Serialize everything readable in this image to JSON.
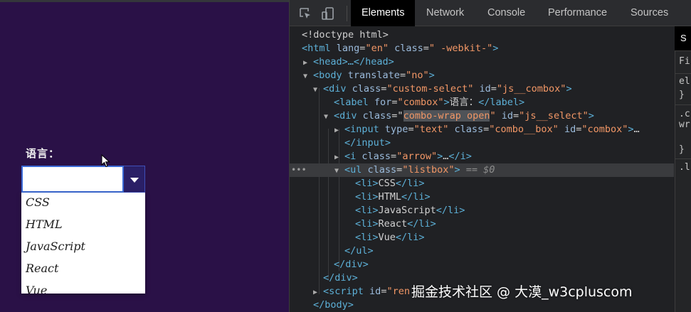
{
  "page": {
    "label": "语言：",
    "combo_value": "",
    "options": [
      "CSS",
      "HTML",
      "JavaScript",
      "React",
      "Vue"
    ]
  },
  "devtools": {
    "tabs": [
      "Elements",
      "Network",
      "Console",
      "Performance",
      "Sources"
    ],
    "active_tab": "Elements",
    "side_tab": "S",
    "side_rows": [
      "Fi",
      "el",
      "}",
      ".c",
      "wr",
      "}",
      ".l"
    ],
    "dom_lines": {
      "l0": "<!doctype html>",
      "l1_tag": "<html",
      "l1_a1": "lang",
      "l1_v1": "\"en\"",
      "l1_a2": "class",
      "l1_v2": "\" -webkit-\"",
      "l2": "<head>…</head>",
      "l3_tag": "<body",
      "l3_a": "translate",
      "l3_v": "\"no\"",
      "l4_a1": "class",
      "l4_v1": "\"custom-select\"",
      "l4_a2": "id",
      "l4_v2": "\"js__combox\"",
      "l5_a": "for",
      "l5_v": "\"combox\"",
      "l5_text": "语言：",
      "l6_a1": "class",
      "l6_v1": "combo-wrap open",
      "l6_a2": "id",
      "l6_v2": "\"js__select\"",
      "l7_a1": "type",
      "l7_v1": "\"text\"",
      "l7_a2": "class",
      "l7_v2": "\"combo__box\"",
      "l7_a3": "id",
      "l7_v3": "\"combox\"",
      "l8": "</input>",
      "l9_a": "class",
      "l9_v": "\"arrow\"",
      "l10_a": "class",
      "l10_v": "\"listbox\"",
      "l10_eq": "== $0",
      "l16": "</ul>",
      "l17": "</div>",
      "l18": "</div>",
      "l19_a": "id",
      "l19_v": "\"ren",
      "l20": "</body>"
    },
    "ellipsis": "…"
  },
  "watermark": "掘金技术社区 @ 大漠_w3cpluscom"
}
